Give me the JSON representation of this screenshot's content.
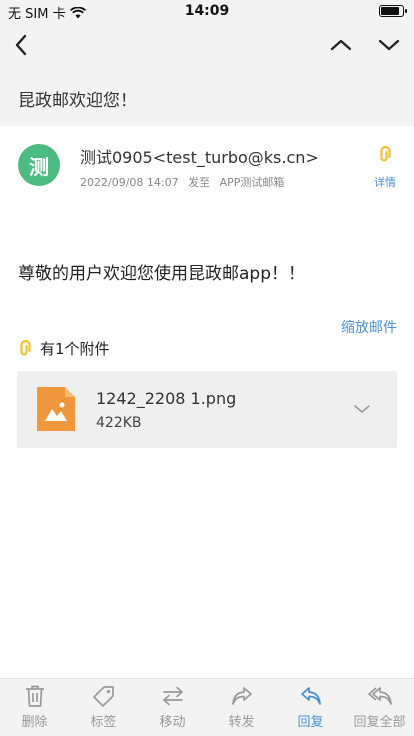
{
  "status_bar": {
    "carrier": "无 SIM 卡",
    "time": "14:09",
    "battery_level": 0.85
  },
  "nav": {
    "subject": "昆政邮欢迎您！"
  },
  "sender": {
    "avatar_char": "测",
    "name": "测试0905<test_turbo@ks.cn>",
    "date": "2022/09/08 14:07",
    "sent_to_label": "发至",
    "recipient": "APP测试邮箱",
    "details_label": "详情"
  },
  "body": {
    "text": "尊敬的用户欢迎您使用昆政邮app！！"
  },
  "attachments": {
    "zoom_label": "缩放邮件",
    "header": "有1个附件",
    "items": [
      {
        "name": "1242_2208 1.png",
        "size": "422KB"
      }
    ]
  },
  "tabs": [
    {
      "label": "删除",
      "icon": "trash-icon"
    },
    {
      "label": "标签",
      "icon": "tag-icon"
    },
    {
      "label": "移动",
      "icon": "move-icon"
    },
    {
      "label": "转发",
      "icon": "forward-icon"
    },
    {
      "label": "回复",
      "icon": "reply-icon"
    },
    {
      "label": "回复全部",
      "icon": "reply-all-icon"
    }
  ],
  "colors": {
    "accent": "#4a90d9",
    "avatar": "#4cbb82",
    "file_icon": "#f0963c",
    "clip": "#f2c230"
  }
}
